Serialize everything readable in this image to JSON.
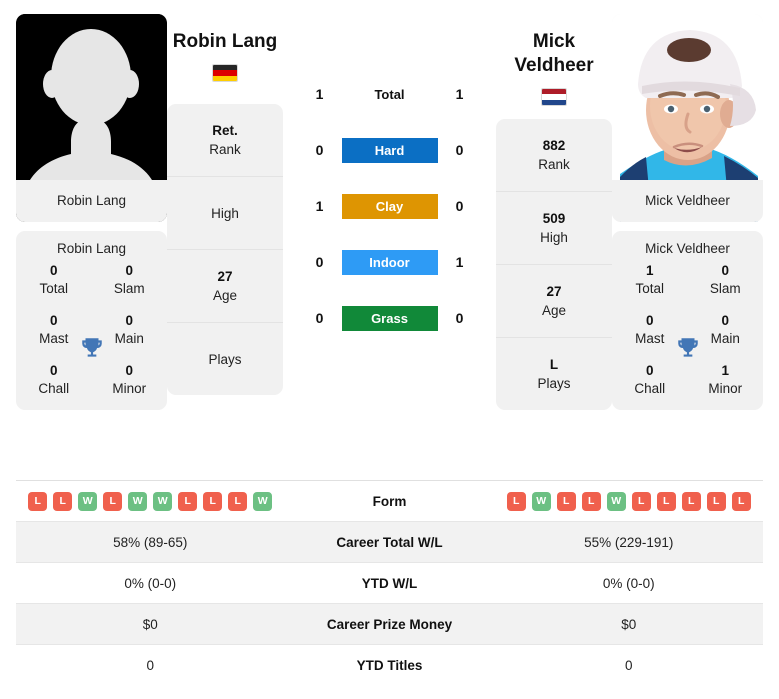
{
  "players": {
    "left": {
      "name": "Robin Lang",
      "photo_caption": "Robin Lang",
      "photo_type": "silhouette-placeholder",
      "country": "Germany",
      "flag_colors": [
        "#262626",
        "#dd0000",
        "#ffce00"
      ],
      "info": [
        {
          "value": "Ret.",
          "label": "Rank"
        },
        {
          "value": "",
          "label": "High"
        },
        {
          "value": "27",
          "label": "Age"
        },
        {
          "value": "",
          "label": "Plays"
        }
      ],
      "titles": [
        {
          "value": "0",
          "label": "Total"
        },
        {
          "value": "0",
          "label": "Slam"
        },
        {
          "value": "0",
          "label": "Mast"
        },
        {
          "value": "0",
          "label": "Main"
        },
        {
          "value": "0",
          "label": "Chall"
        },
        {
          "value": "0",
          "label": "Minor"
        }
      ],
      "form": [
        "L",
        "L",
        "W",
        "L",
        "W",
        "W",
        "L",
        "L",
        "L",
        "W"
      ]
    },
    "right": {
      "name": "Mick Veldheer",
      "photo_caption": "Mick Veldheer",
      "photo_type": "player-headshot",
      "country": "Netherlands",
      "flag_colors": [
        "#ae1c28",
        "#ffffff",
        "#21468b"
      ],
      "info": [
        {
          "value": "882",
          "label": "Rank"
        },
        {
          "value": "509",
          "label": "High"
        },
        {
          "value": "27",
          "label": "Age"
        },
        {
          "value": "L",
          "label": "Plays"
        }
      ],
      "titles": [
        {
          "value": "1",
          "label": "Total"
        },
        {
          "value": "0",
          "label": "Slam"
        },
        {
          "value": "0",
          "label": "Mast"
        },
        {
          "value": "0",
          "label": "Main"
        },
        {
          "value": "0",
          "label": "Chall"
        },
        {
          "value": "1",
          "label": "Minor"
        }
      ],
      "form": [
        "L",
        "W",
        "L",
        "L",
        "W",
        "L",
        "L",
        "L",
        "L",
        "L"
      ]
    }
  },
  "h2h": {
    "rows": [
      {
        "left": "1",
        "label": "Total",
        "right": "1",
        "color": ""
      },
      {
        "left": "0",
        "label": "Hard",
        "right": "0",
        "color": "#0b6fc4"
      },
      {
        "left": "1",
        "label": "Clay",
        "right": "0",
        "color": "#de9502"
      },
      {
        "left": "0",
        "label": "Indoor",
        "right": "1",
        "color": "#2e9bf5"
      },
      {
        "left": "0",
        "label": "Grass",
        "right": "0",
        "color": "#118939"
      }
    ]
  },
  "stats": {
    "rows": [
      {
        "label": "Form",
        "left": "",
        "right": "",
        "type": "form"
      },
      {
        "label": "Career Total W/L",
        "left": "58% (89-65)",
        "right": "55% (229-191)",
        "type": "text"
      },
      {
        "label": "YTD W/L",
        "left": "0% (0-0)",
        "right": "0% (0-0)",
        "type": "text"
      },
      {
        "label": "Career Prize Money",
        "left": "$0",
        "right": "$0",
        "type": "text"
      },
      {
        "label": "YTD Titles",
        "left": "0",
        "right": "0",
        "type": "text"
      }
    ]
  },
  "icons": {
    "trophy": "trophy-icon"
  }
}
